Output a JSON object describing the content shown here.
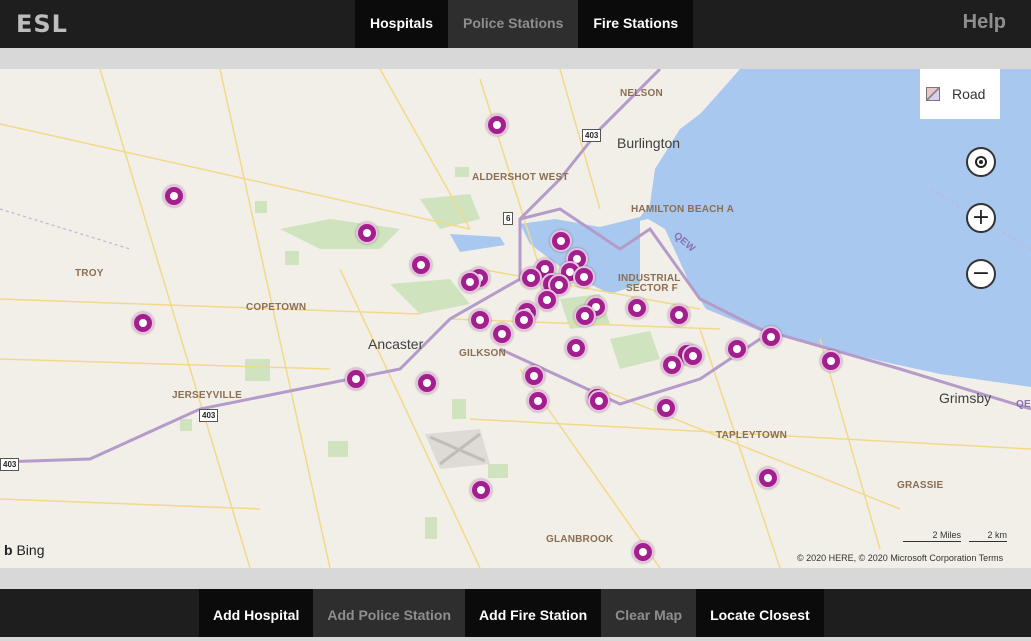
{
  "header": {
    "logo": "ESL",
    "help": "Help",
    "tabs": [
      "Hospitals",
      "Police Stations",
      "Fire Stations"
    ]
  },
  "map": {
    "map_type": "Road",
    "places": {
      "nelson": "NELSON",
      "burlington": "Burlington",
      "aldershot": "ALDERSHOT WEST",
      "hamilton_beach": "HAMILTON BEACH A",
      "industrial_a": "INDUSTRIAL",
      "industrial_b": "SECTOR F",
      "troy": "TROY",
      "copetown": "COPETOWN",
      "ancaster": "Ancaster",
      "gilkson": "GILKSON",
      "jerseyville": "JERSEYVILLE",
      "tapleytown": "TAPLEYTOWN",
      "grimsby": "Grimsby",
      "grassie": "GRASSIE",
      "glanbrook": "GLANBROOK",
      "qew": "QEW",
      "qew2": "QEW"
    },
    "shields": {
      "hwy403a": "403",
      "hwy403b": "403",
      "hwy403c": "403",
      "hwy6": "6"
    },
    "attribution": "Bing",
    "copyright": "© 2020 HERE, © 2020 Microsoft Corporation  Terms",
    "scale_miles": "2 Miles",
    "scale_km": "2 km"
  },
  "footer": {
    "buttons": [
      "Add Hospital",
      "Add Police Station",
      "Add Fire Station",
      "Clear Map",
      "Locate Closest"
    ]
  }
}
